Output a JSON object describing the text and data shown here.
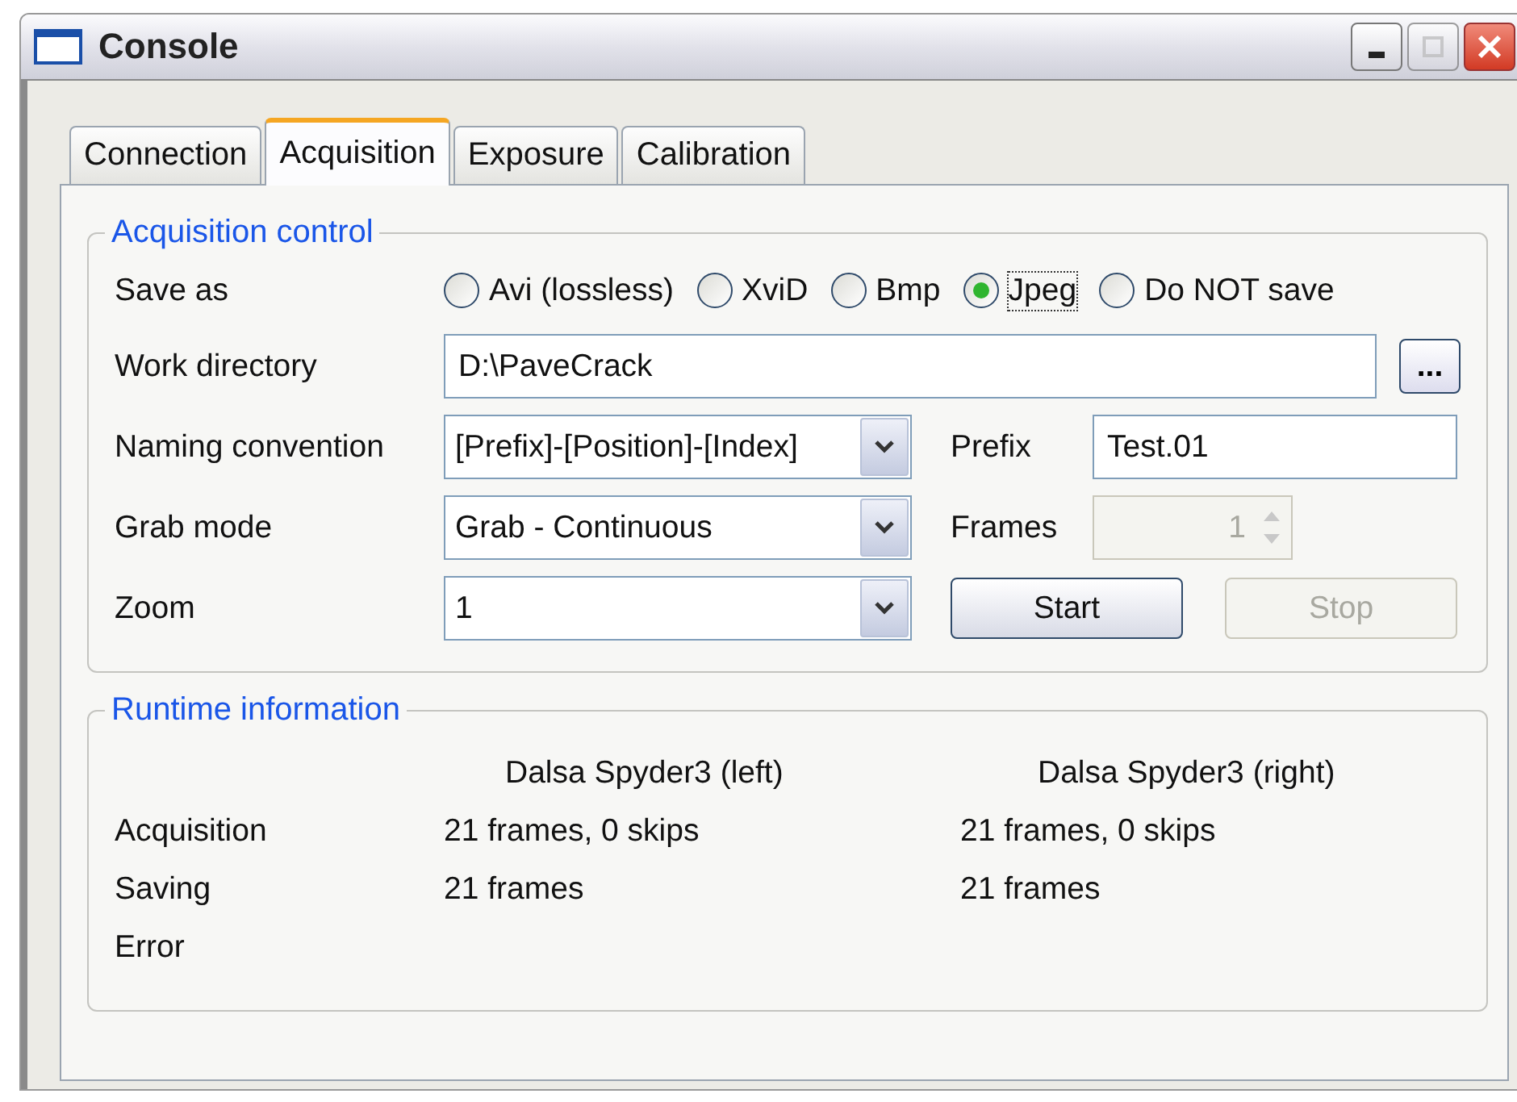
{
  "window": {
    "title": "Console"
  },
  "tabs": [
    {
      "label": "Connection",
      "selected": false
    },
    {
      "label": "Acquisition",
      "selected": true
    },
    {
      "label": "Exposure",
      "selected": false
    },
    {
      "label": "Calibration",
      "selected": false
    }
  ],
  "acquisition_control": {
    "title": "Acquisition control",
    "save_as": {
      "label": "Save as",
      "options": [
        {
          "label": "Avi (lossless)",
          "selected": false
        },
        {
          "label": "XviD",
          "selected": false
        },
        {
          "label": "Bmp",
          "selected": false
        },
        {
          "label": "Jpeg",
          "selected": true
        },
        {
          "label": "Do NOT save",
          "selected": false
        }
      ]
    },
    "work_directory": {
      "label": "Work directory",
      "value": "D:\\PaveCrack",
      "browse_button": "..."
    },
    "naming_convention": {
      "label": "Naming convention",
      "value": "[Prefix]-[Position]-[Index]"
    },
    "prefix": {
      "label": "Prefix",
      "value": "Test.01"
    },
    "grab_mode": {
      "label": "Grab mode",
      "value": "Grab - Continuous"
    },
    "frames": {
      "label": "Frames",
      "value": "1",
      "disabled": true
    },
    "zoom": {
      "label": "Zoom",
      "value": "1"
    },
    "start_button": {
      "label": "Start",
      "disabled": false
    },
    "stop_button": {
      "label": "Stop",
      "disabled": true
    }
  },
  "runtime_information": {
    "title": "Runtime information",
    "columns": [
      "Dalsa Spyder3 (left)",
      "Dalsa Spyder3 (right)"
    ],
    "rows": [
      {
        "label": "Acquisition",
        "values": [
          "21 frames, 0 skips",
          "21 frames, 0 skips"
        ]
      },
      {
        "label": "Saving",
        "values": [
          "21 frames",
          "21 frames"
        ]
      },
      {
        "label": "Error"
      }
    ]
  }
}
